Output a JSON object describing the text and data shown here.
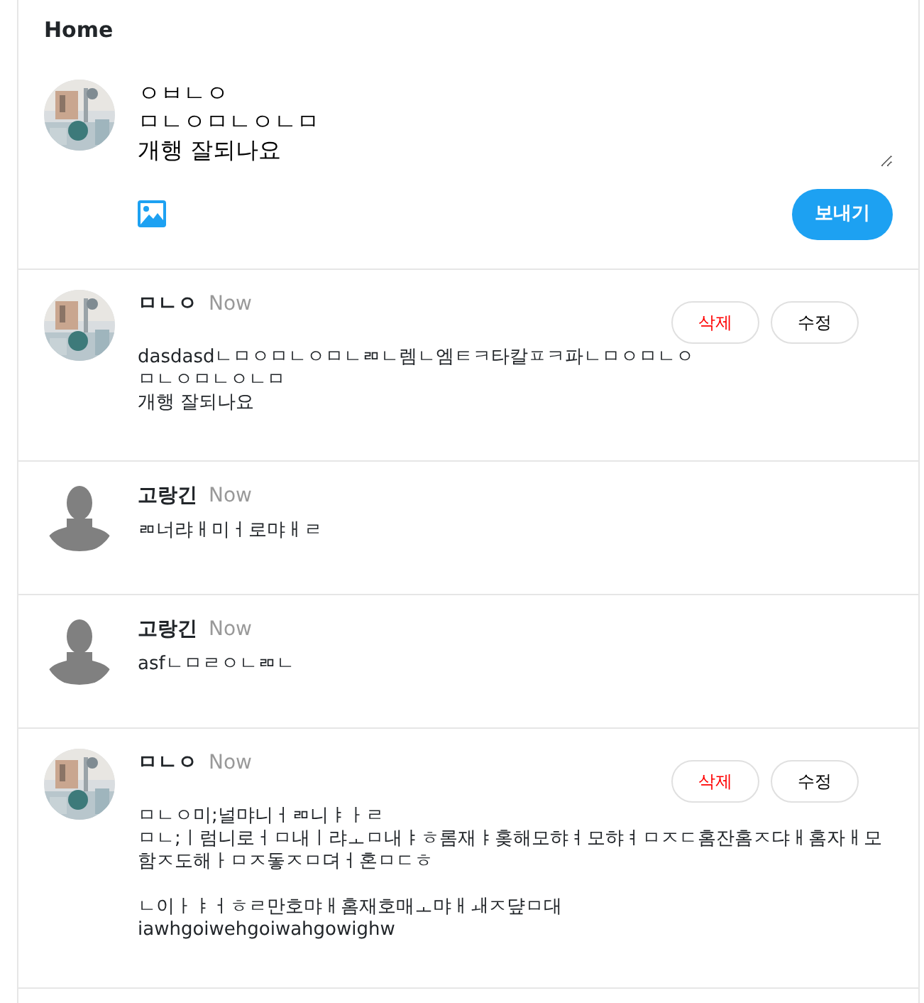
{
  "header": {
    "title": "Home"
  },
  "composer": {
    "avatar": {
      "kind": "picture"
    },
    "lines": [
      "ㅇㅂㄴㅇ",
      "ㅁㄴㅇㅁㄴㅇㄴㅁ",
      "개행 잘되나요"
    ],
    "submit": "보내기"
  },
  "posts": [
    {
      "avatar": {
        "kind": "picture"
      },
      "author": "ㅁㄴㅇ",
      "time": "Now",
      "paragraphs": [
        [
          "dasdasdㄴㅁㅇㅁㄴㅇㅁㄴㄻㄴ렘ㄴ엠ㅌㅋ타칼ㅍㅋ파ㄴㅁㅇㅁㄴㅇ",
          "ㅁㄴㅇㅁㄴㅇㄴㅁ",
          "개행 잘되나요"
        ]
      ],
      "actions": [
        {
          "label": "삭제",
          "kind": "danger"
        },
        {
          "label": "수정",
          "kind": "plain"
        }
      ]
    },
    {
      "avatar": {
        "kind": "silhouette"
      },
      "author": "고랑긴",
      "time": "Now",
      "paragraphs": [
        [
          "ㄻ너랴ㅐ미ㅓ로먀ㅐㄹ"
        ]
      ]
    },
    {
      "avatar": {
        "kind": "silhouette"
      },
      "author": "고랑긴",
      "time": "Now",
      "paragraphs": [
        [
          "asfㄴㅁㄹㅇㄴㄻㄴ"
        ]
      ]
    },
    {
      "avatar": {
        "kind": "picture"
      },
      "author": "ㅁㄴㅇ",
      "time": "Now",
      "paragraphs": [
        [
          "ㅁㄴㅇ미;널먀니ㅓㄻ니ㅑㅏㄹ",
          "ㅁㄴ;ㅣ럼니로ㅓㅁ내ㅣ랴ㅗㅁ내ㅑㅎ롬재ㅑ홎해모햐ㅕ모햐ㅕㅁㅈㄷ홈잔홈ㅈ댜ㅐ홈자ㅐ모함ㅈ도해ㅏㅁㅈ돟ㅈㅁ뎌ㅓ혼ㅁㄷㅎ"
        ],
        [
          "ㄴ이ㅏㅑㅓㅎㄹ만호먀ㅐ홈재호매ㅗ먀ㅐㅙㅈ댶ㅁ대",
          "iawhgoiwehgoiwahgowighw"
        ]
      ],
      "actions": [
        {
          "label": "삭제",
          "kind": "danger"
        },
        {
          "label": "수정",
          "kind": "plain"
        }
      ]
    }
  ]
}
